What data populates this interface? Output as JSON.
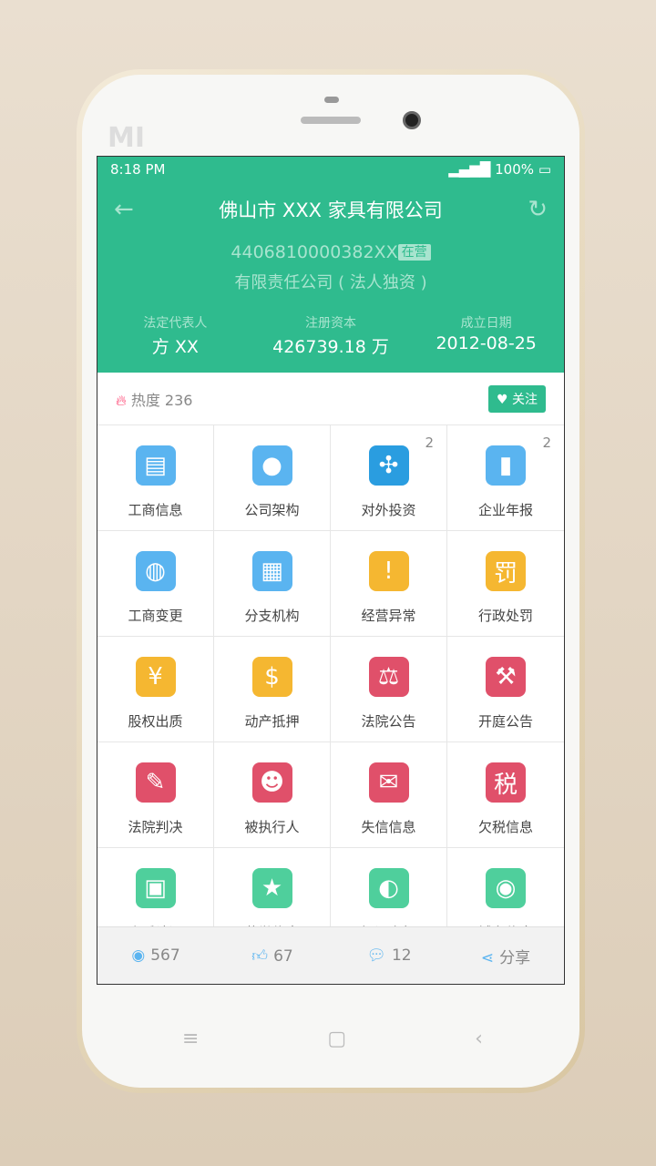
{
  "status": {
    "time": "8:18 PM",
    "battery": "100%"
  },
  "header": {
    "title": "佛山市 XXX 家具有限公司",
    "reg_no": "4406810000382XX",
    "status_badge": "在营",
    "company_type": "有限责任公司 ( 法人独资 )",
    "stats": [
      {
        "label": "法定代表人",
        "value": "方 XX"
      },
      {
        "label": "注册资本",
        "value": "426739.18 万"
      },
      {
        "label": "成立日期",
        "value": "2012-08-25"
      }
    ]
  },
  "heat": {
    "label": "热度 236",
    "follow": "关注"
  },
  "grid": [
    {
      "label": "工商信息",
      "icon": "document-info-icon",
      "color": "#5ab4f0",
      "glyph": "▤"
    },
    {
      "label": "公司架构",
      "icon": "person-icon",
      "color": "#5ab4f0",
      "glyph": "●"
    },
    {
      "label": "对外投资",
      "icon": "network-icon",
      "color": "#2a9de0",
      "glyph": "✣",
      "count": "2"
    },
    {
      "label": "企业年报",
      "icon": "bar-chart-icon",
      "color": "#5ab4f0",
      "glyph": "▮",
      "count": "2"
    },
    {
      "label": "工商变更",
      "icon": "change-icon",
      "color": "#5ab4f0",
      "glyph": "◍"
    },
    {
      "label": "分支机构",
      "icon": "org-chart-icon",
      "color": "#5ab4f0",
      "glyph": "▦"
    },
    {
      "label": "经营异常",
      "icon": "warning-icon",
      "color": "#f5b731",
      "glyph": "!"
    },
    {
      "label": "行政处罚",
      "icon": "penalty-icon",
      "color": "#f5b731",
      "glyph": "罚"
    },
    {
      "label": "股权出质",
      "icon": "coin-hand-icon",
      "color": "#f5b731",
      "glyph": "¥"
    },
    {
      "label": "动产抵押",
      "icon": "money-bag-icon",
      "color": "#f5b731",
      "glyph": "$"
    },
    {
      "label": "法院公告",
      "icon": "scales-icon",
      "color": "#e0506a",
      "glyph": "⚖"
    },
    {
      "label": "开庭公告",
      "icon": "gavel-icon",
      "color": "#e0506a",
      "glyph": "⚒"
    },
    {
      "label": "法院判决",
      "icon": "scroll-icon",
      "color": "#e0506a",
      "glyph": "✎"
    },
    {
      "label": "被执行人",
      "icon": "police-icon",
      "color": "#e0506a",
      "glyph": "☻"
    },
    {
      "label": "失信信息",
      "icon": "document-stamp-icon",
      "color": "#e0506a",
      "glyph": "✉"
    },
    {
      "label": "欠税信息",
      "icon": "tax-icon",
      "color": "#e0506a",
      "glyph": "税"
    },
    {
      "label": "资质认证",
      "icon": "certificate-icon",
      "color": "#4fcf9c",
      "glyph": "▣"
    },
    {
      "label": "荣誉信息",
      "icon": "award-icon",
      "color": "#4fcf9c",
      "glyph": "★"
    },
    {
      "label": "知识产权",
      "icon": "ip-icon",
      "color": "#4fcf9c",
      "glyph": "◐"
    },
    {
      "label": "域名信息",
      "icon": "globe-cursor-icon",
      "color": "#4fcf9c",
      "glyph": "◉"
    }
  ],
  "bottom": [
    {
      "icon": "eye-icon",
      "glyph": "◉",
      "value": "567"
    },
    {
      "icon": "thumbs-up-icon",
      "glyph": "👍︎",
      "value": "67"
    },
    {
      "icon": "comment-icon",
      "glyph": "💬︎",
      "value": "12"
    },
    {
      "icon": "share-icon",
      "glyph": "⋖",
      "value": "分享"
    }
  ]
}
